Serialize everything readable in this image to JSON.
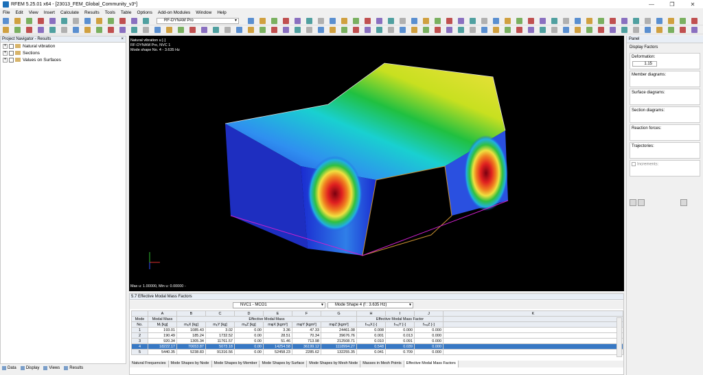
{
  "window": {
    "title": "RFEM 5.25.01 x64 - [23013_FEM_Global_Community_v3*]"
  },
  "menu": [
    "File",
    "Edit",
    "View",
    "Insert",
    "Calculate",
    "Results",
    "Tools",
    "Table",
    "Options",
    "Add-on Modules",
    "Window",
    "Help"
  ],
  "toolbar": {
    "module_combo": "RF-DYNAM Pro"
  },
  "navigator": {
    "title": "Project Navigator - Results",
    "items": [
      "Natural vibration",
      "Sections",
      "Values on Surfaces"
    ],
    "tabs": [
      "Data",
      "Display",
      "Views",
      "Results"
    ]
  },
  "viewport": {
    "info_lines": [
      "Natural vibration u [-]",
      "RF-DYNAM Pro, NVC 1",
      "Mode shape No. 4 - 3.635 Hz"
    ],
    "footer": "Max u: 1.00000, Min u: 0.00000 -"
  },
  "panel": {
    "title": "Panel",
    "subtitle": "Display Factors",
    "groups": [
      "Deformation:",
      "Member diagrams:",
      "Surface diagrams:",
      "Section diagrams:",
      "Reaction forces:",
      "Trajectories:",
      "Increments:"
    ],
    "deformation_value": "1.15"
  },
  "table": {
    "title": "5.7 Effective Modal Mass Factors",
    "nvc_combo": "NVC1 - MCO1",
    "mode_combo": "Mode Shape 4 (f : 3.635 Hz)",
    "col_letters": [
      "A",
      "B",
      "C",
      "D",
      "E",
      "F",
      "G",
      "H",
      "I",
      "J",
      "K"
    ],
    "group_headers": {
      "mode": "Mode",
      "modal_mass": "Modal Mass",
      "effective": "Effective Modal Mass",
      "factor": "Effective Modal Mass Factor"
    },
    "sub_headers": [
      "No.",
      "Mᵢ [kg]",
      "mₑX [kg]",
      "mₑY [kg]",
      "mₑZ [kg]",
      "mφX [kgm²]",
      "mφY [kgm²]",
      "mφZ [kgm²]",
      "fₘₑX [-]",
      "fₘₑY [-]",
      "fₘₑZ [-]"
    ],
    "rows": [
      [
        "1",
        "193.01",
        "1085.43",
        "3.02",
        "0.00",
        "3.36",
        "47.33",
        "24461.08",
        "0.008",
        "0.000",
        "0.000"
      ],
      [
        "2",
        "190.49",
        "185.24",
        "1732.52",
        "0.00",
        "28.51",
        "70.34",
        "39676.76",
        "0.001",
        "0.013",
        "0.000"
      ],
      [
        "3",
        "920.34",
        "1305.34",
        "11761.57",
        "0.00",
        "51.46",
        "713.98",
        "212508.71",
        "0.010",
        "0.091",
        "0.000"
      ],
      [
        "4",
        "18222.17",
        "70653.87",
        "5073.18",
        "0.00",
        "14254.58",
        "36199.12",
        "1118994.27",
        "0.548",
        "0.039",
        "0.000"
      ],
      [
        "5",
        "5440.35",
        "5238.83",
        "91316.56",
        "0.00",
        "52458.23",
        "2285.62",
        "132255.35",
        "0.041",
        "0.709",
        "0.000"
      ]
    ],
    "selected_row": 3,
    "bottom_tabs": [
      "Natural Frequencies",
      "Mode Shapes by Node",
      "Mode Shapes by Member",
      "Mode Shapes by Surface",
      "Mode Shapes by Mesh Node",
      "Masses in Mesh Points",
      "Effective Modal Mass Factors"
    ]
  }
}
